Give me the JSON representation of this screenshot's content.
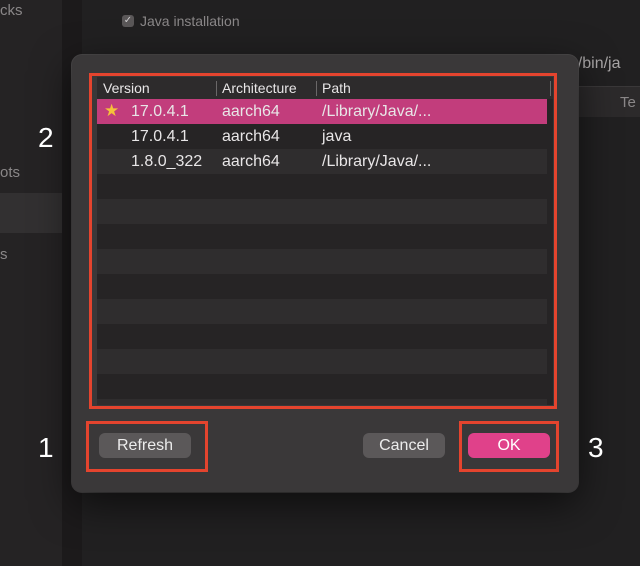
{
  "background": {
    "sidebar_fragments": [
      "cks",
      "ots",
      "s"
    ],
    "java_installation_label": "Java installation",
    "path_fragment": "ne/bin/ja",
    "column_fragment": "Te"
  },
  "dialog": {
    "columns": [
      "Version",
      "Architecture",
      "Path"
    ],
    "rows": [
      {
        "version": "17.0.4.1",
        "architecture": "aarch64",
        "path": "/Library/Java/...",
        "default": true,
        "selected": true
      },
      {
        "version": "17.0.4.1",
        "architecture": "aarch64",
        "path": "java",
        "default": false,
        "selected": false
      },
      {
        "version": "1.8.0_322",
        "architecture": "aarch64",
        "path": "/Library/Java/...",
        "default": false,
        "selected": false
      }
    ],
    "buttons": {
      "refresh": "Refresh",
      "cancel": "Cancel",
      "ok": "OK"
    }
  },
  "annotations": {
    "label_1": "1",
    "label_2": "2",
    "label_3": "3",
    "highlight_color": "#e4442e"
  },
  "colors": {
    "accent": "#e0418a",
    "selected_row": "#c23d7c",
    "default_star": "#f5c23a"
  },
  "icons": {
    "default": "star-icon",
    "checkbox": "checkmark-icon"
  }
}
